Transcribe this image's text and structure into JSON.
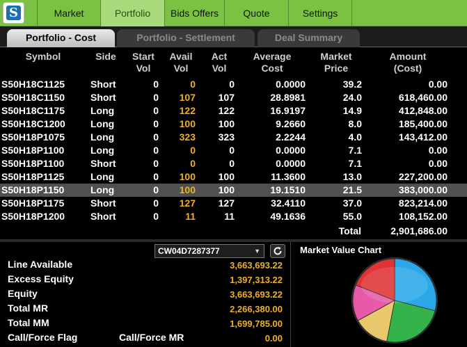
{
  "nav": {
    "tabs": [
      {
        "label": "Market",
        "active": false
      },
      {
        "label": "Portfolio",
        "active": true
      },
      {
        "label": "Bids Offers",
        "active": false
      },
      {
        "label": "Quote",
        "active": false
      },
      {
        "label": "Settings",
        "active": false
      }
    ]
  },
  "subtabs": [
    {
      "label": "Portfolio - Cost",
      "active": true
    },
    {
      "label": "Portfolio - Settlement",
      "active": false
    },
    {
      "label": "Deal Summary",
      "active": false
    }
  ],
  "table": {
    "headers": {
      "symbol": "Symbol",
      "side": "Side",
      "start_vol": [
        "Start",
        "Vol"
      ],
      "avail_vol": [
        "Avail",
        "Vol"
      ],
      "act_vol": [
        "Act",
        "Vol"
      ],
      "avg_cost": [
        "Average",
        "Cost"
      ],
      "market_price": [
        "Market",
        "Price"
      ],
      "amount": [
        "Amount",
        "(Cost)"
      ]
    },
    "rows": [
      {
        "symbol": "S50H18C1125",
        "side": "Short",
        "start": "0",
        "avail": "0",
        "act": "0",
        "avg": "0.0000",
        "price": "39.2",
        "amount": "0.00",
        "selected": false
      },
      {
        "symbol": "S50H18C1150",
        "side": "Short",
        "start": "0",
        "avail": "107",
        "act": "107",
        "avg": "28.8981",
        "price": "24.0",
        "amount": "618,460.00",
        "selected": false
      },
      {
        "symbol": "S50H18C1175",
        "side": "Long",
        "start": "0",
        "avail": "122",
        "act": "122",
        "avg": "16.9197",
        "price": "14.9",
        "amount": "412,848.00",
        "selected": false
      },
      {
        "symbol": "S50H18C1200",
        "side": "Long",
        "start": "0",
        "avail": "100",
        "act": "100",
        "avg": "9.2660",
        "price": "8.0",
        "amount": "185,400.00",
        "selected": false
      },
      {
        "symbol": "S50H18P1075",
        "side": "Long",
        "start": "0",
        "avail": "323",
        "act": "323",
        "avg": "2.2244",
        "price": "4.0",
        "amount": "143,412.00",
        "selected": false
      },
      {
        "symbol": "S50H18P1100",
        "side": "Long",
        "start": "0",
        "avail": "0",
        "act": "0",
        "avg": "0.0000",
        "price": "7.1",
        "amount": "0.00",
        "selected": false
      },
      {
        "symbol": "S50H18P1100",
        "side": "Short",
        "start": "0",
        "avail": "0",
        "act": "0",
        "avg": "0.0000",
        "price": "7.1",
        "amount": "0.00",
        "selected": false
      },
      {
        "symbol": "S50H18P1125",
        "side": "Long",
        "start": "0",
        "avail": "100",
        "act": "100",
        "avg": "11.3600",
        "price": "13.0",
        "amount": "227,200.00",
        "selected": false
      },
      {
        "symbol": "S50H18P1150",
        "side": "Long",
        "start": "0",
        "avail": "100",
        "act": "100",
        "avg": "19.1510",
        "price": "21.5",
        "amount": "383,000.00",
        "selected": true
      },
      {
        "symbol": "S50H18P1175",
        "side": "Short",
        "start": "0",
        "avail": "127",
        "act": "127",
        "avg": "32.4110",
        "price": "37.0",
        "amount": "823,214.00",
        "selected": false
      },
      {
        "symbol": "S50H18P1200",
        "side": "Short",
        "start": "0",
        "avail": "11",
        "act": "11",
        "avg": "49.1636",
        "price": "55.0",
        "amount": "108,152.00",
        "selected": false
      }
    ],
    "total_label": "Total",
    "total_value": "2,901,686.00"
  },
  "account": {
    "selected": "CW04D7287377",
    "items": [
      {
        "label": "Line Available",
        "value": "3,663,693.22"
      },
      {
        "label": "Excess Equity",
        "value": "1,397,313.22"
      },
      {
        "label": "Equity",
        "value": "3,663,693.22"
      },
      {
        "label": "Total MR",
        "value": "2,266,380.00"
      },
      {
        "label": "Total MM",
        "value": "1,699,785.00"
      }
    ],
    "flag_label": "Call/Force Flag",
    "flag_sub_label": "Call/Force MR",
    "flag_value": "0.00"
  },
  "chart_data": {
    "type": "pie",
    "title": "Market Value Chart",
    "values": [
      29,
      24,
      14,
      14,
      19
    ],
    "colors": [
      "#2aa7e8",
      "#34b34a",
      "#e8c86a",
      "#e85aa8",
      "#e03434"
    ]
  },
  "colors": {
    "nav_green": "#7cc242",
    "accent_yellow": "#f0b020"
  }
}
